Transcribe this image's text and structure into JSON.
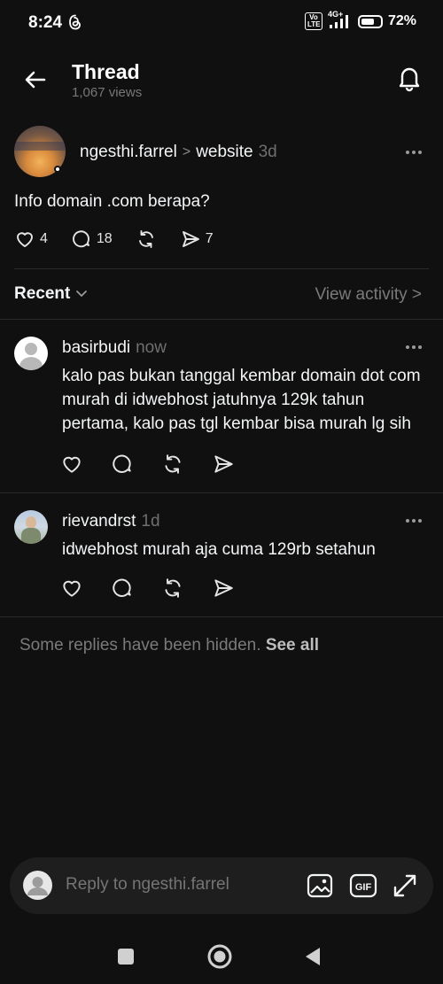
{
  "status": {
    "time": "8:24",
    "network": "4G+",
    "volte": "Vo LTE",
    "battery_text": "72%",
    "battery_level": 0.72
  },
  "header": {
    "title": "Thread",
    "views": "1,067 views"
  },
  "post": {
    "username": "ngesthi.farrel",
    "separator": ">",
    "topic": "website",
    "time": "3d",
    "text": "Info domain .com berapa?",
    "likes": "4",
    "replies": "18",
    "shares": "7"
  },
  "recent": {
    "label": "Recent",
    "view_activity": "View activity >"
  },
  "replies": [
    {
      "username": "basirbudi",
      "time": "now",
      "text": "kalo pas bukan tanggal kembar domain dot com murah di idwebhost jatuhnya 129k tahun pertama, kalo pas tgl kembar bisa murah lg sih"
    },
    {
      "username": "rievandrst",
      "time": "1d",
      "text": "idwebhost murah aja cuma 129rb setahun"
    }
  ],
  "hidden_note": {
    "text": "Some replies have been hidden.",
    "link": "See all"
  },
  "composer": {
    "placeholder": "Reply to ngesthi.farrel",
    "gif_label": "GIF"
  },
  "icons": {
    "back": "arrow-left-icon",
    "bell": "bell-icon",
    "like": "heart-icon",
    "reply": "comment-icon",
    "repost": "repost-icon",
    "share": "send-icon",
    "image": "image-icon",
    "gif": "gif-icon",
    "expand": "expand-icon"
  },
  "colors": {
    "background": "#101010",
    "text": "#f3f5f7",
    "muted": "#7a7a7a",
    "composer": "#1e1e1e"
  }
}
